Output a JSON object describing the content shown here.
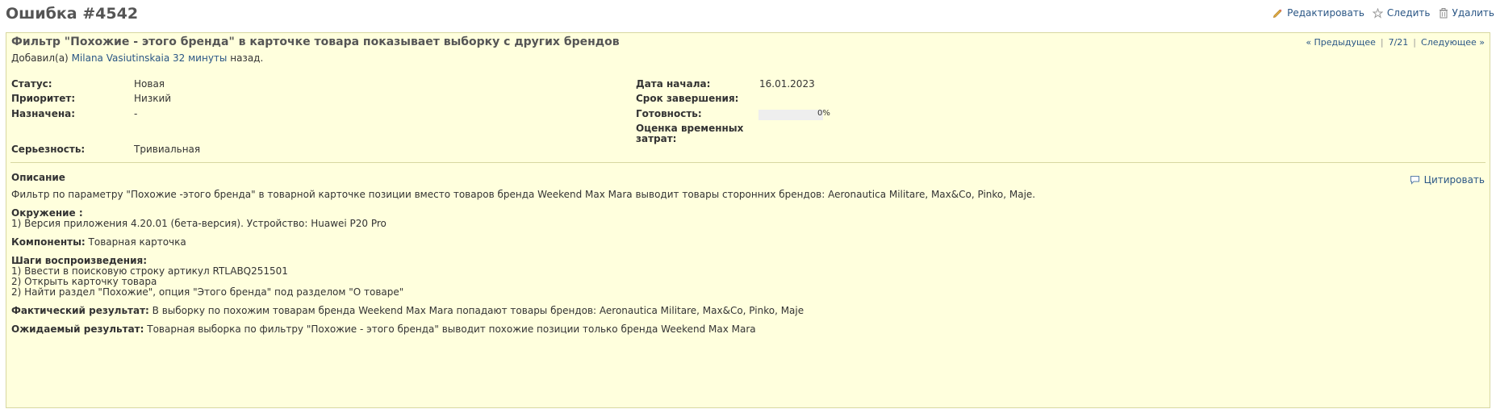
{
  "header": {
    "title": "Ошибка #4542",
    "actions": {
      "edit": "Редактировать",
      "watch": "Следить",
      "delete": "Удалить"
    }
  },
  "issue": {
    "subject": "Фильтр \"Похожие - этого бренда\" в карточке товара показывает выборку с других брендов",
    "author_prefix": "Добавил(а)",
    "author_name": "Milana Vasiutinskaia",
    "author_time": "32 минуты",
    "author_suffix": "назад.",
    "navigation": {
      "previous": "« Предыдущее",
      "position": "7/21",
      "next": "Следующее »"
    },
    "attributes": {
      "status_label": "Статус:",
      "status_value": "Новая",
      "priority_label": "Приоритет:",
      "priority_value": "Низкий",
      "assigned_label": "Назначена:",
      "assigned_value": "-",
      "severity_label": "Серьезность:",
      "severity_value": "Тривиальная",
      "start_label": "Дата начала:",
      "start_value": "16.01.2023",
      "due_label": "Срок завершения:",
      "due_value": "",
      "done_label": "Готовность:",
      "done_value": "0%",
      "done_ratio": 0,
      "estimate_label_1": "Оценка временных",
      "estimate_label_2": "затрат:",
      "estimate_value": ""
    },
    "description": {
      "title": "Описание",
      "quote": "Цитировать",
      "intro": "Фильтр по параметру \"Похожие -этого бренда\" в товарной карточке позиции вместо товаров бренда Weekend Max Mara выводит товары сторонних брендов: Aeronautica Militare, Max&Co, Pinko, Maje.",
      "env_label": "Окружение :",
      "env_text": "1) Версия приложения 4.20.01 (бета-версия). Устройство: Huawei P20 Pro",
      "comp_label": "Компоненты:",
      "comp_text": " Товарная карточка",
      "steps_label": "Шаги воспроизведения:",
      "step1": "1) Ввести в поисковую строку артикул RTLABQ251501",
      "step2": "2) Открыть карточку товара",
      "step3": "2) Найти раздел \"Похожие\", опция \"Этого бренда\" под разделом \"О товаре\"",
      "actual_label": "Фактический результат:",
      "actual_text": " В выборку по похожим товарам бренда Weekend Max Mara попадают товары брендов: Aeronautica Militare, Max&Co, Pinko, Maje",
      "expected_label": "Ожидаемый результат:",
      "expected_text": " Товарная выборка по фильтру \"Похожие - этого бренда\" выводит похожие позиции только бренда Weekend Max Mara"
    }
  },
  "colors": {
    "issue_bg": "#FFFFDD",
    "link": "#2A5685",
    "title": "#555555"
  }
}
